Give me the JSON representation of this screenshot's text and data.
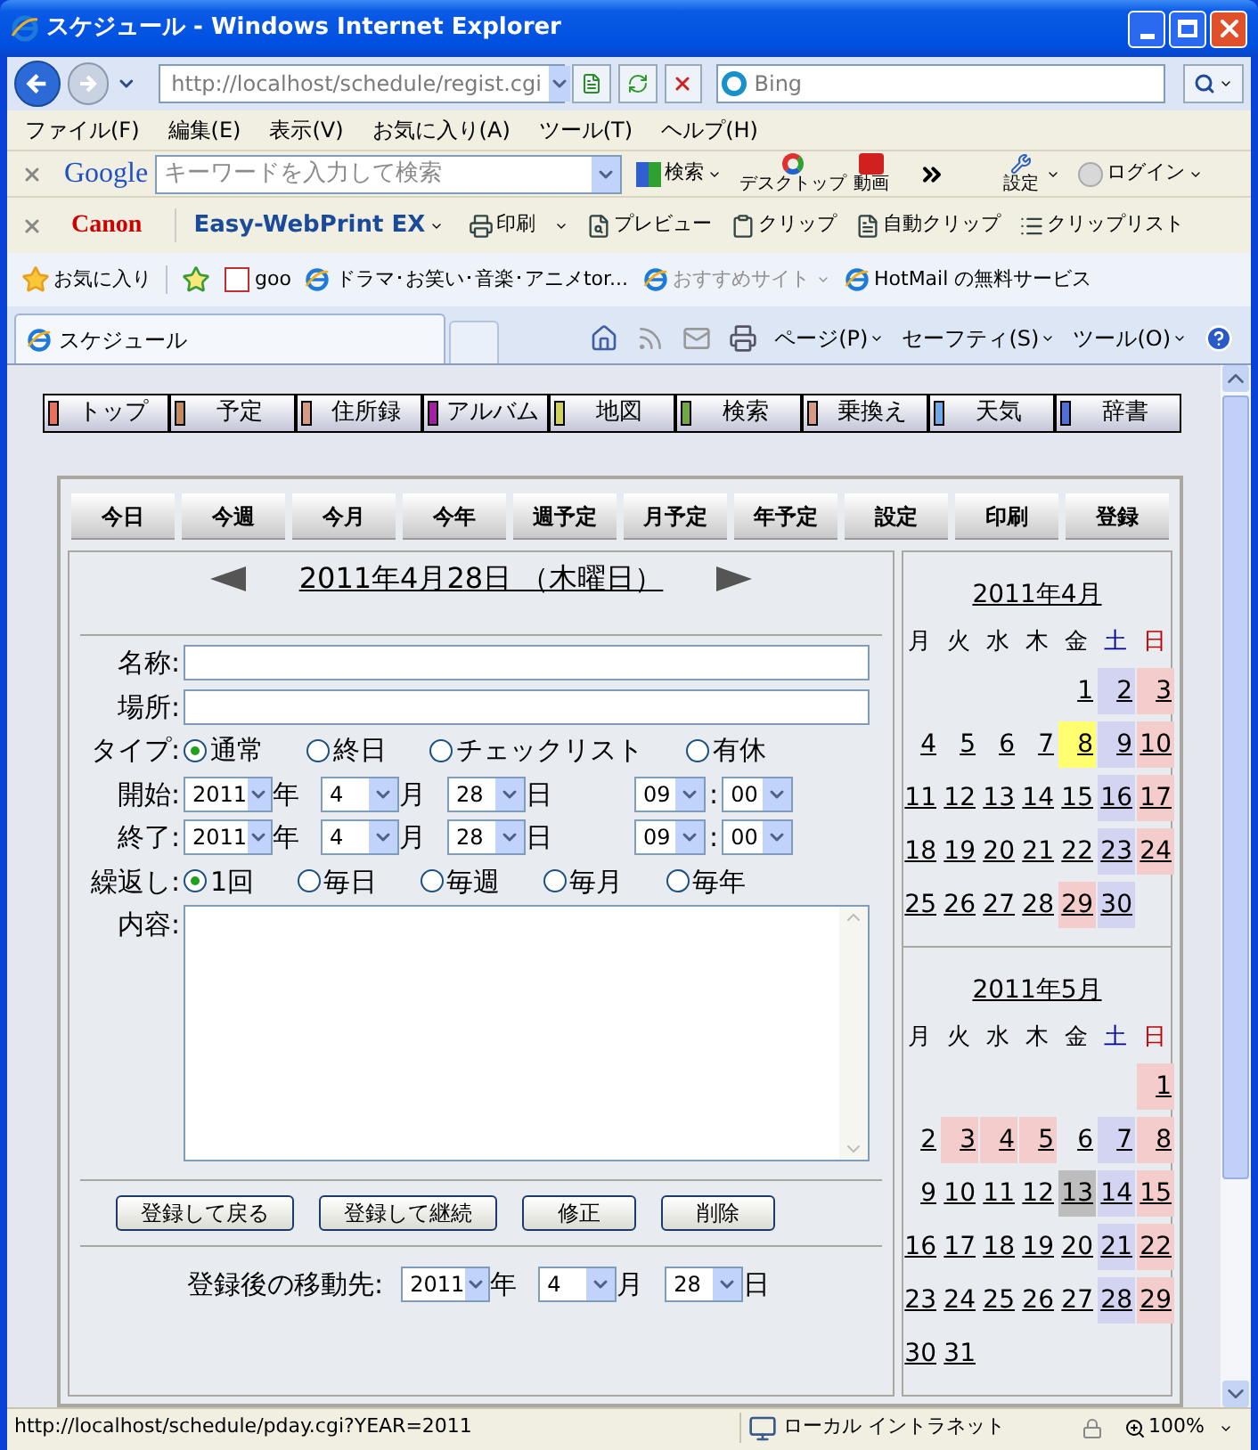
{
  "window": {
    "title": "スケジュール - Windows Internet Explorer"
  },
  "address_bar": {
    "url": "http://localhost/schedule/regist.cgi"
  },
  "search_box": {
    "placeholder": "Bing"
  },
  "menu_bar": [
    "ファイル(F)",
    "編集(E)",
    "表示(V)",
    "お気に入り(A)",
    "ツール(T)",
    "ヘルプ(H)"
  ],
  "google_toolbar": {
    "logo": "Google",
    "placeholder": "キーワードを入力して検索",
    "search": "検索",
    "desktop": "デスクトップ",
    "video": "動画",
    "settings": "設定",
    "login": "ログイン"
  },
  "canon_toolbar": {
    "logo": "Canon",
    "product": "Easy-WebPrint EX",
    "buttons": [
      {
        "label": "印刷",
        "kind": "print"
      },
      {
        "label": "プレビュー",
        "kind": "preview"
      },
      {
        "label": "クリップ",
        "kind": "clip"
      },
      {
        "label": "自動クリップ",
        "kind": "autoclip"
      },
      {
        "label": "クリップリスト",
        "kind": "cliplist"
      }
    ]
  },
  "favorites_bar": {
    "label": "お気に入り",
    "links": [
      {
        "label": "goo",
        "kind": "goo",
        "disabled": false
      },
      {
        "label": "ドラマ･お笑い･音楽･アニメtor...",
        "kind": "ie",
        "disabled": false
      },
      {
        "label": "おすすめサイト",
        "kind": "ie",
        "disabled": true
      },
      {
        "label": "HotMail の無料サービス",
        "kind": "page",
        "disabled": false
      }
    ]
  },
  "tab": {
    "title": "スケジュール"
  },
  "command_bar": [
    "ページ(P)",
    "セーフティ(S)",
    "ツール(O)"
  ],
  "nav_menu": [
    {
      "label": "トップ",
      "color": "#e87060"
    },
    {
      "label": "予定",
      "color": "#c08a60"
    },
    {
      "label": "住所録",
      "color": "#d89a88"
    },
    {
      "label": "アルバム",
      "color": "#a020a0"
    },
    {
      "label": "地図",
      "color": "#d0d060"
    },
    {
      "label": "検索",
      "color": "#70a848"
    },
    {
      "label": "乗換え",
      "color": "#d89a88"
    },
    {
      "label": "天気",
      "color": "#70a8e8"
    },
    {
      "label": "辞書",
      "color": "#5070d8"
    }
  ],
  "toolbar_buttons": [
    "今日",
    "今週",
    "今月",
    "今年",
    "週予定",
    "月予定",
    "年予定",
    "設定",
    "印刷",
    "登録"
  ],
  "date_heading": "2011年4月28日 （木曜日）",
  "form": {
    "name": {
      "label": "名称:"
    },
    "place": {
      "label": "場所:"
    },
    "type": {
      "label": "タイプ:",
      "options": [
        {
          "label": "通常",
          "selected": true
        },
        {
          "label": "終日",
          "selected": false
        },
        {
          "label": "チェックリスト",
          "selected": false
        },
        {
          "label": "有休",
          "selected": false
        }
      ]
    },
    "start": {
      "label": "開始:",
      "selects": [
        {
          "value": "2011",
          "unit": "年"
        },
        {
          "value": "4",
          "unit": "月"
        },
        {
          "value": "28",
          "unit": "日"
        },
        {
          "value": "09",
          "unit": ":"
        },
        {
          "value": "00"
        }
      ]
    },
    "end": {
      "label": "終了:",
      "selects": [
        {
          "value": "2011",
          "unit": "年"
        },
        {
          "value": "4",
          "unit": "月"
        },
        {
          "value": "28",
          "unit": "日"
        },
        {
          "value": "09",
          "unit": ":"
        },
        {
          "value": "00"
        }
      ]
    },
    "repeat": {
      "label": "繰返し:",
      "options": [
        {
          "label": "1回",
          "selected": true
        },
        {
          "label": "毎日",
          "selected": false
        },
        {
          "label": "毎週",
          "selected": false
        },
        {
          "label": "毎月",
          "selected": false
        },
        {
          "label": "毎年",
          "selected": false
        }
      ]
    },
    "content": {
      "label": "内容:"
    }
  },
  "buttons": [
    "登録して戻る",
    "登録して継続",
    "修正",
    "削除"
  ],
  "after": {
    "label": "登録後の移動先:",
    "selects": [
      {
        "value": "2011",
        "unit": "年"
      },
      {
        "value": "4",
        "unit": "月"
      },
      {
        "value": "28",
        "unit": "日"
      }
    ]
  },
  "calendars": [
    {
      "title": "2011年4月",
      "weekdays": [
        {
          "label": "月",
          "kind": "weekday"
        },
        {
          "label": "火",
          "kind": "weekday"
        },
        {
          "label": "水",
          "kind": "weekday"
        },
        {
          "label": "木",
          "kind": "weekday"
        },
        {
          "label": "金",
          "kind": "weekday"
        },
        {
          "label": "土",
          "kind": "saturday"
        },
        {
          "label": "日",
          "kind": "sunday"
        }
      ],
      "days": [
        {
          "kind": "blank"
        },
        {
          "kind": "blank"
        },
        {
          "kind": "blank"
        },
        {
          "kind": "blank"
        },
        {
          "d": "1",
          "kind": "plain"
        },
        {
          "d": "2",
          "kind": "saturday"
        },
        {
          "d": "3",
          "kind": "holiday"
        },
        {
          "d": "4",
          "kind": "plain"
        },
        {
          "d": "5",
          "kind": "plain"
        },
        {
          "d": "6",
          "kind": "plain"
        },
        {
          "d": "7",
          "kind": "plain"
        },
        {
          "d": "8",
          "kind": "highlight"
        },
        {
          "d": "9",
          "kind": "saturday"
        },
        {
          "d": "10",
          "kind": "holiday"
        },
        {
          "d": "11",
          "kind": "plain"
        },
        {
          "d": "12",
          "kind": "plain"
        },
        {
          "d": "13",
          "kind": "plain"
        },
        {
          "d": "14",
          "kind": "plain"
        },
        {
          "d": "15",
          "kind": "plain"
        },
        {
          "d": "16",
          "kind": "saturday"
        },
        {
          "d": "17",
          "kind": "holiday"
        },
        {
          "d": "18",
          "kind": "plain"
        },
        {
          "d": "19",
          "kind": "plain"
        },
        {
          "d": "20",
          "kind": "plain"
        },
        {
          "d": "21",
          "kind": "plain"
        },
        {
          "d": "22",
          "kind": "plain"
        },
        {
          "d": "23",
          "kind": "saturday"
        },
        {
          "d": "24",
          "kind": "holiday"
        },
        {
          "d": "25",
          "kind": "plain"
        },
        {
          "d": "26",
          "kind": "plain"
        },
        {
          "d": "27",
          "kind": "plain"
        },
        {
          "d": "28",
          "kind": "plain"
        },
        {
          "d": "29",
          "kind": "holiday"
        },
        {
          "d": "30",
          "kind": "saturday"
        }
      ]
    },
    {
      "title": "2011年5月",
      "weekdays": [
        {
          "label": "月",
          "kind": "weekday"
        },
        {
          "label": "火",
          "kind": "weekday"
        },
        {
          "label": "水",
          "kind": "weekday"
        },
        {
          "label": "木",
          "kind": "weekday"
        },
        {
          "label": "金",
          "kind": "weekday"
        },
        {
          "label": "土",
          "kind": "saturday"
        },
        {
          "label": "日",
          "kind": "sunday"
        }
      ],
      "days": [
        {
          "kind": "blank"
        },
        {
          "kind": "blank"
        },
        {
          "kind": "blank"
        },
        {
          "kind": "blank"
        },
        {
          "kind": "blank"
        },
        {
          "kind": "blank"
        },
        {
          "d": "1",
          "kind": "holiday"
        },
        {
          "d": "2",
          "kind": "plain"
        },
        {
          "d": "3",
          "kind": "holiday"
        },
        {
          "d": "4",
          "kind": "holiday"
        },
        {
          "d": "5",
          "kind": "holiday"
        },
        {
          "d": "6",
          "kind": "plain"
        },
        {
          "d": "7",
          "kind": "saturday"
        },
        {
          "d": "8",
          "kind": "holiday"
        },
        {
          "d": "9",
          "kind": "plain"
        },
        {
          "d": "10",
          "kind": "plain"
        },
        {
          "d": "11",
          "kind": "plain"
        },
        {
          "d": "12",
          "kind": "plain"
        },
        {
          "d": "13",
          "kind": "marked"
        },
        {
          "d": "14",
          "kind": "saturday"
        },
        {
          "d": "15",
          "kind": "holiday"
        },
        {
          "d": "16",
          "kind": "plain"
        },
        {
          "d": "17",
          "kind": "plain"
        },
        {
          "d": "18",
          "kind": "plain"
        },
        {
          "d": "19",
          "kind": "plain"
        },
        {
          "d": "20",
          "kind": "plain"
        },
        {
          "d": "21",
          "kind": "saturday"
        },
        {
          "d": "22",
          "kind": "holiday"
        },
        {
          "d": "23",
          "kind": "plain"
        },
        {
          "d": "24",
          "kind": "plain"
        },
        {
          "d": "25",
          "kind": "plain"
        },
        {
          "d": "26",
          "kind": "plain"
        },
        {
          "d": "27",
          "kind": "plain"
        },
        {
          "d": "28",
          "kind": "saturday"
        },
        {
          "d": "29",
          "kind": "holiday"
        },
        {
          "d": "30",
          "kind": "plain"
        },
        {
          "d": "31",
          "kind": "plain"
        }
      ]
    }
  ],
  "status_bar": {
    "url": "http://localhost/schedule/pday.cgi?YEAR=2011",
    "zone": "ローカル イントラネット",
    "zoom": "100%"
  }
}
